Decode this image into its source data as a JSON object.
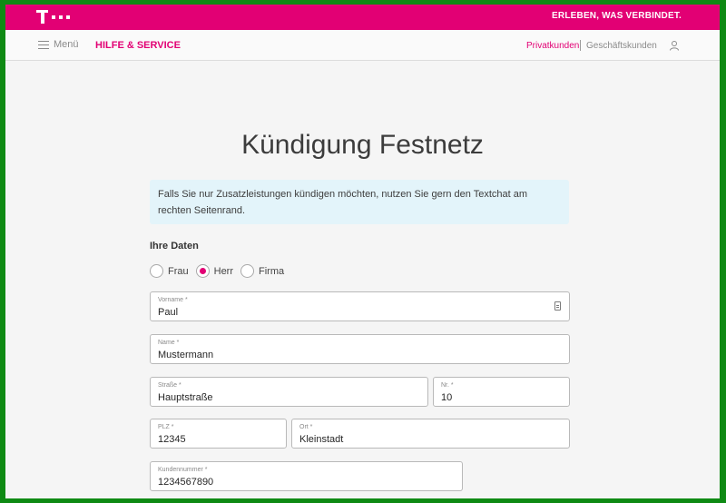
{
  "header": {
    "slogan": "ERLEBEN, WAS VERBINDET.",
    "brand_color": "#e20074"
  },
  "nav": {
    "menu_label": "Menü",
    "section_title": "HILFE & SERVICE",
    "privatkunden": "Privatkunden",
    "geschaeftskunden": "Geschäftskunden"
  },
  "page": {
    "title": "Kündigung Festnetz",
    "info_text": "Falls Sie nur Zusatzleistungen kündigen möchten, nutzen Sie gern den Textchat am rechten Seitenrand.",
    "section_label": "Ihre Daten"
  },
  "salutation": {
    "options": [
      "Frau",
      "Herr",
      "Firma"
    ],
    "selected": "Herr"
  },
  "form": {
    "vorname": {
      "label": "Vorname *",
      "value": "Paul"
    },
    "name": {
      "label": "Name *",
      "value": "Mustermann"
    },
    "strasse": {
      "label": "Straße *",
      "value": "Hauptstraße"
    },
    "nr": {
      "label": "Nr. *",
      "value": "10"
    },
    "plz": {
      "label": "PLZ *",
      "value": "12345"
    },
    "ort": {
      "label": "Ort *",
      "value": "Kleinstadt"
    },
    "kundennummer": {
      "label": "Kundennummer *",
      "value": "1234567890"
    }
  }
}
